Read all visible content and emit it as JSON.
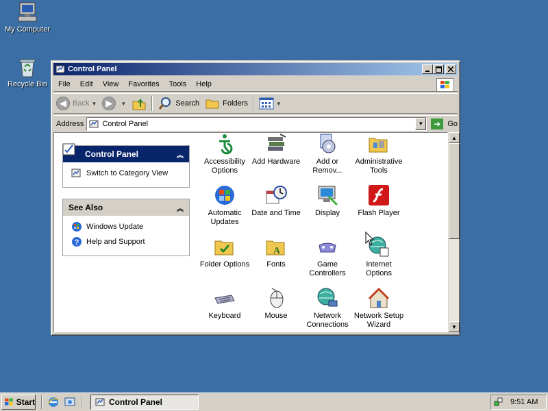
{
  "desktop": {
    "icons": [
      {
        "label": "My Computer",
        "icon": "my-computer-icon"
      },
      {
        "label": "Recycle Bin",
        "icon": "recycle-bin-icon"
      }
    ]
  },
  "window": {
    "title": "Control Panel",
    "controls": {
      "minimize": "_",
      "maximize": "□",
      "close": "✕"
    },
    "menu": [
      "File",
      "Edit",
      "View",
      "Favorites",
      "Tools",
      "Help"
    ],
    "toolbar": {
      "back": "Back",
      "search": "Search",
      "folders": "Folders"
    },
    "address": {
      "label": "Address",
      "value": "Control Panel",
      "go": "Go"
    }
  },
  "task_pane": {
    "control_panel": {
      "title": "Control Panel",
      "links": [
        "Switch to Category View"
      ]
    },
    "see_also": {
      "title": "See Also",
      "links": [
        "Windows Update",
        "Help and Support"
      ]
    }
  },
  "items": [
    {
      "label": "Accessibility Options",
      "lines": [
        "Accessibility",
        "Options"
      ],
      "icon": "accessibility-icon"
    },
    {
      "label": "Add Hardware",
      "lines": [
        "Add Hardware",
        ""
      ],
      "icon": "add-hardware-icon"
    },
    {
      "label": "Add or Remov...",
      "lines": [
        "Add or",
        "Remov..."
      ],
      "icon": "add-remove-programs-icon"
    },
    {
      "label": "Administrative Tools",
      "lines": [
        "Administrative",
        "Tools"
      ],
      "icon": "administrative-tools-icon"
    },
    {
      "label": "Automatic Updates",
      "lines": [
        "Automatic",
        "Updates"
      ],
      "icon": "automatic-updates-icon"
    },
    {
      "label": "Date and Time",
      "lines": [
        "Date and Time",
        ""
      ],
      "icon": "date-time-icon"
    },
    {
      "label": "Display",
      "lines": [
        "Display",
        ""
      ],
      "icon": "display-icon"
    },
    {
      "label": "Flash Player",
      "lines": [
        "Flash Player",
        ""
      ],
      "icon": "flash-player-icon"
    },
    {
      "label": "Folder Options",
      "lines": [
        "Folder Options",
        ""
      ],
      "icon": "folder-options-icon"
    },
    {
      "label": "Fonts",
      "lines": [
        "Fonts",
        ""
      ],
      "icon": "fonts-icon"
    },
    {
      "label": "Game Controllers",
      "lines": [
        "Game",
        "Controllers"
      ],
      "icon": "game-controllers-icon"
    },
    {
      "label": "Internet Options",
      "lines": [
        "Internet",
        "Options"
      ],
      "icon": "internet-options-icon"
    },
    {
      "label": "Keyboard",
      "lines": [
        "Keyboard",
        ""
      ],
      "icon": "keyboard-icon"
    },
    {
      "label": "Mouse",
      "lines": [
        "Mouse",
        ""
      ],
      "icon": "mouse-icon"
    },
    {
      "label": "Network Connections",
      "lines": [
        "Network",
        "Connections"
      ],
      "icon": "network-connections-icon"
    },
    {
      "label": "Network Setup Wizard",
      "lines": [
        "Network Setup",
        "Wizard"
      ],
      "icon": "network-setup-wizard-icon"
    }
  ],
  "taskbar": {
    "start": "Start",
    "task": "Control Panel",
    "clock": "9:51 AM"
  },
  "colors": {
    "desktop": "#3a6ea5",
    "title_active": "#0a246a",
    "task_pane_header": "#08246b"
  }
}
